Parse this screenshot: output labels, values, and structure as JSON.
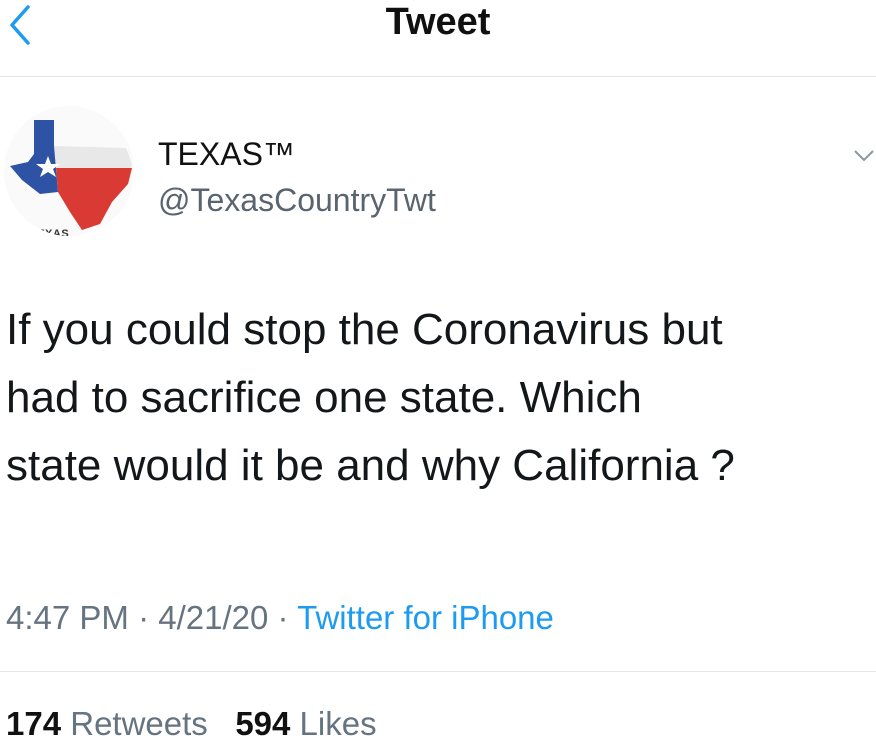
{
  "header": {
    "title": "Tweet",
    "back_icon": "chevron-left-icon",
    "accent": "#1d9bf0"
  },
  "author": {
    "display_name": "TEXAS™",
    "handle": "@TexasCountryTwt",
    "avatar_text": "TEXAS"
  },
  "tweet": {
    "lines": [
      "If you could stop the Coronavirus but",
      "had to sacrifice one state. Which",
      "state would it be and why California ?"
    ],
    "time": "4:47 PM",
    "date": "4/21/20",
    "separator": "·",
    "source": "Twitter for iPhone"
  },
  "stats": {
    "retweets_count": "174",
    "retweets_label": "Retweets",
    "likes_count": "594",
    "likes_label": "Likes"
  }
}
